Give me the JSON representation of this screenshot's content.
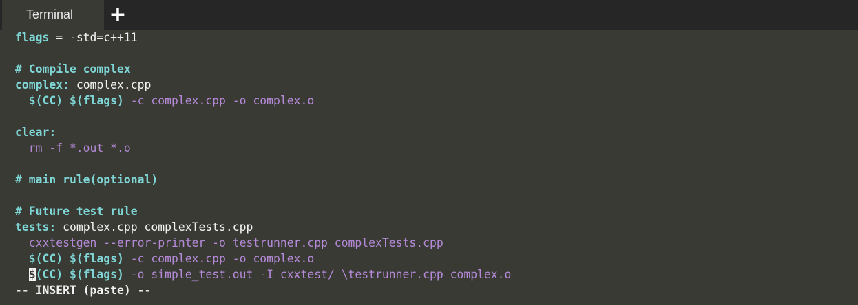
{
  "tab": {
    "label": "Terminal",
    "add_icon": "plus-icon"
  },
  "lines": {
    "l1": {
      "a": "flags",
      "b": " = -std=c++11"
    },
    "l3": "# Compile complex",
    "l4": {
      "a": "complex:",
      "b": " complex.cpp"
    },
    "l5": {
      "a": "  $(CC) $(flags)",
      "b": " -c complex.cpp -o complex.o"
    },
    "l7": "clear:",
    "l8": "  rm -f *.out *.o",
    "l10": "# main rule(optional)",
    "l12": "# Future test rule",
    "l13": {
      "a": "tests:",
      "b": " complex.cpp complexTests.cpp"
    },
    "l14": "  cxxtestgen --error-printer -o testrunner.cpp complexTests.cpp",
    "l15": {
      "a": "  $(CC) $(flags)",
      "b": " -c complex.cpp -o complex.o"
    },
    "l16": {
      "indent": "  ",
      "cursor": "$",
      "a": "(CC) $(flags)",
      "b": " -o simple_test.out -I cxxtest/ \\testrunner.cpp complex.o"
    }
  },
  "status": "-- INSERT (paste) --",
  "colors": {
    "background": "#3a3a34",
    "tabbar": "#262626",
    "keyword": "#7ed6d6",
    "command": "#b48ad8",
    "text": "#f2f2f2"
  }
}
